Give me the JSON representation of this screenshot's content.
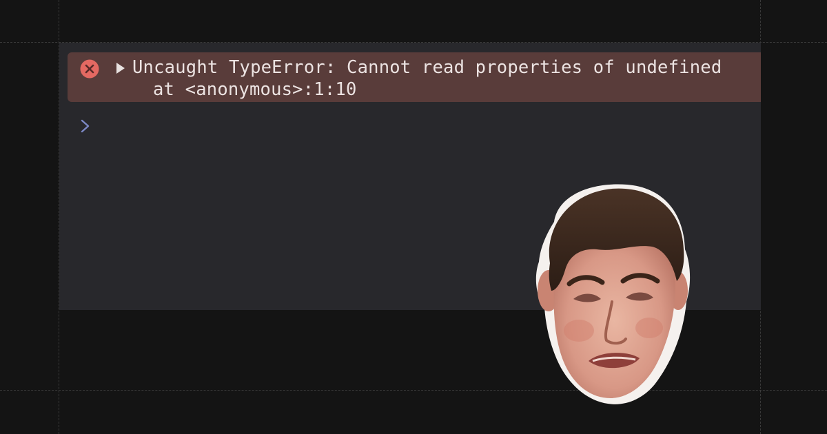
{
  "console": {
    "error": {
      "icon": "error-circle-x-icon",
      "expand_icon": "triangle-right-icon",
      "message": "Uncaught TypeError: Cannot read properties of undefined",
      "stack_line": "at <anonymous>:1:10"
    },
    "prompt_icon": "chevron-right-icon"
  },
  "overlay": {
    "image": "crying-face-image"
  },
  "colors": {
    "background": "#141414",
    "panel": "#28282c",
    "error_bg": "#593c3a",
    "error_icon": "#e46962",
    "error_text": "#ece3e2",
    "prompt": "#7c88c4"
  }
}
